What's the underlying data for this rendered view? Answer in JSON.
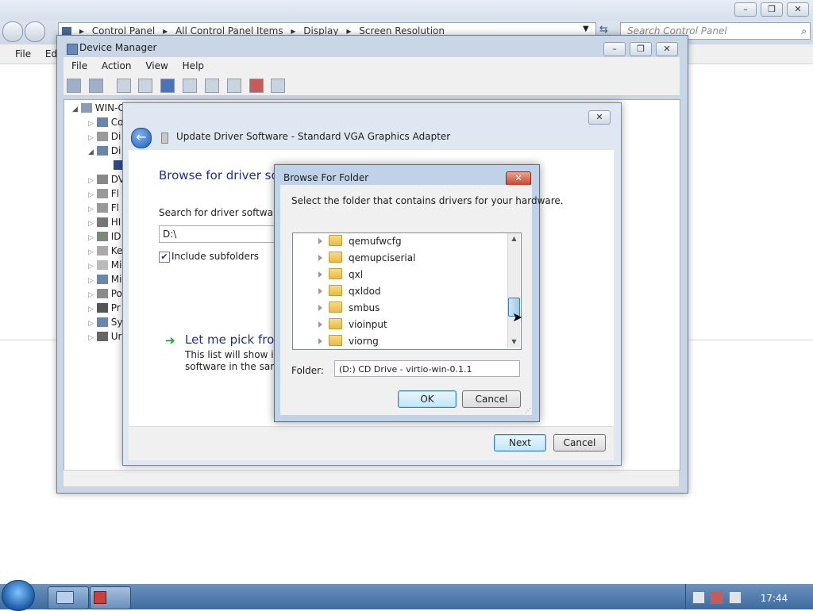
{
  "control_panel": {
    "breadcrumb": [
      "Control Panel",
      "All Control Panel Items",
      "Display",
      "Screen Resolution"
    ],
    "search_placeholder": "Search Control Panel",
    "menu": [
      "File",
      "Edit"
    ]
  },
  "device_manager": {
    "title": "Device Manager",
    "menu": [
      "File",
      "Action",
      "View",
      "Help"
    ],
    "tree": {
      "root": "WIN-C",
      "items": [
        "Co",
        "Di",
        "Di",
        "DV",
        "Fl",
        "Fl",
        "HI",
        "ID",
        "Ke",
        "Mi",
        "Mi",
        "Po",
        "Pr",
        "Sy",
        "Ur"
      ]
    }
  },
  "update_driver": {
    "title": "Update Driver Software - Standard VGA Graphics Adapter",
    "heading": "Browse for driver sof",
    "search_label": "Search for driver software in",
    "path_value": "D:\\",
    "include_subfolders": "Include subfolders",
    "pick_heading": "Let me pick from",
    "pick_desc_1": "This list will show inst",
    "pick_desc_2": "software in the same",
    "next_label": "Next",
    "cancel_label": "Cancel"
  },
  "browse_folder": {
    "title": "Browse For Folder",
    "prompt": "Select the folder that contains drivers for your hardware.",
    "folders": [
      "qemufwcfg",
      "qemupciserial",
      "qxl",
      "qxldod",
      "smbus",
      "vioinput",
      "viorng"
    ],
    "folder_label": "Folder:",
    "folder_value": "(D:) CD Drive - virtio-win-0.1.1",
    "ok_label": "OK",
    "cancel_label": "Cancel",
    "close_glyph": "✕"
  },
  "taskbar": {
    "clock": "17:44"
  },
  "colors": {
    "heading_blue": "#1e3287",
    "pick_arrow_green": "#1f9c2f",
    "taskbar": "#3d6a9e"
  }
}
